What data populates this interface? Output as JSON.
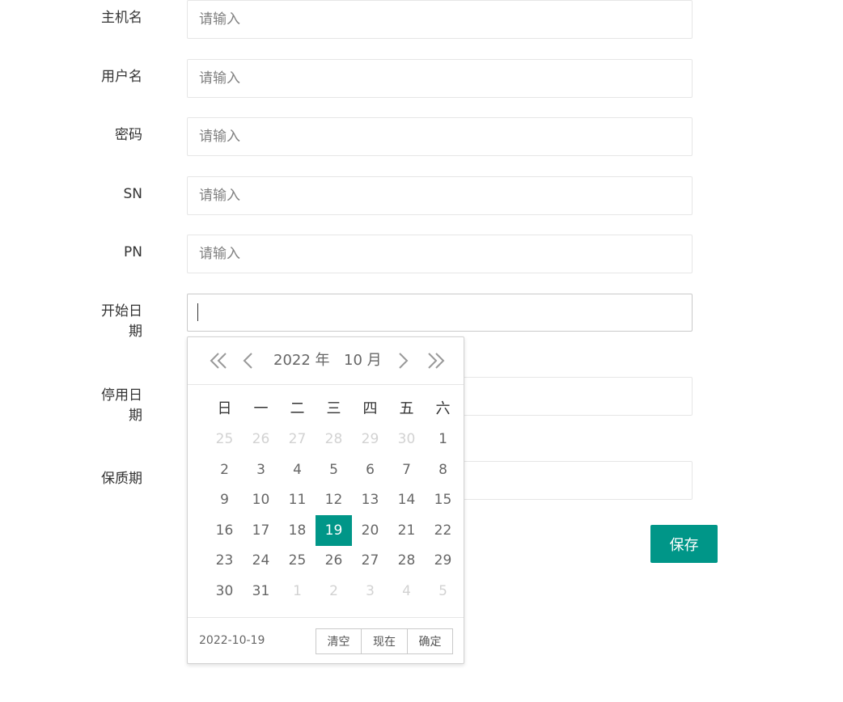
{
  "form": {
    "fields": [
      {
        "label": "主机名",
        "placeholder": "请输入"
      },
      {
        "label": "用户名",
        "placeholder": "请输入"
      },
      {
        "label": "密码",
        "placeholder": "请输入"
      },
      {
        "label": "SN",
        "placeholder": "请输入"
      },
      {
        "label": "PN",
        "placeholder": "请输入"
      },
      {
        "label": "开始日期",
        "value": ""
      },
      {
        "label": "停用日期",
        "value": ""
      },
      {
        "label": "保质期",
        "value": ""
      }
    ],
    "save_label": "保存"
  },
  "datepicker": {
    "year_label": "2022 年",
    "month_label": "10 月",
    "weekdays": [
      "日",
      "一",
      "二",
      "三",
      "四",
      "五",
      "六"
    ],
    "weeks": [
      [
        {
          "d": "25",
          "o": true
        },
        {
          "d": "26",
          "o": true
        },
        {
          "d": "27",
          "o": true
        },
        {
          "d": "28",
          "o": true
        },
        {
          "d": "29",
          "o": true
        },
        {
          "d": "30",
          "o": true
        },
        {
          "d": "1"
        }
      ],
      [
        {
          "d": "2"
        },
        {
          "d": "3"
        },
        {
          "d": "4"
        },
        {
          "d": "5"
        },
        {
          "d": "6"
        },
        {
          "d": "7"
        },
        {
          "d": "8"
        }
      ],
      [
        {
          "d": "9"
        },
        {
          "d": "10"
        },
        {
          "d": "11"
        },
        {
          "d": "12"
        },
        {
          "d": "13"
        },
        {
          "d": "14"
        },
        {
          "d": "15"
        }
      ],
      [
        {
          "d": "16"
        },
        {
          "d": "17"
        },
        {
          "d": "18"
        },
        {
          "d": "19",
          "s": true
        },
        {
          "d": "20"
        },
        {
          "d": "21"
        },
        {
          "d": "22"
        }
      ],
      [
        {
          "d": "23"
        },
        {
          "d": "24"
        },
        {
          "d": "25"
        },
        {
          "d": "26"
        },
        {
          "d": "27"
        },
        {
          "d": "28"
        },
        {
          "d": "29"
        }
      ],
      [
        {
          "d": "30"
        },
        {
          "d": "31"
        },
        {
          "d": "1",
          "o": true
        },
        {
          "d": "2",
          "o": true
        },
        {
          "d": "3",
          "o": true
        },
        {
          "d": "4",
          "o": true
        },
        {
          "d": "5",
          "o": true
        }
      ]
    ],
    "selected_date": "2022-10-19",
    "buttons": {
      "clear": "清空",
      "now": "现在",
      "confirm": "确定"
    },
    "accent_color": "#009688"
  }
}
